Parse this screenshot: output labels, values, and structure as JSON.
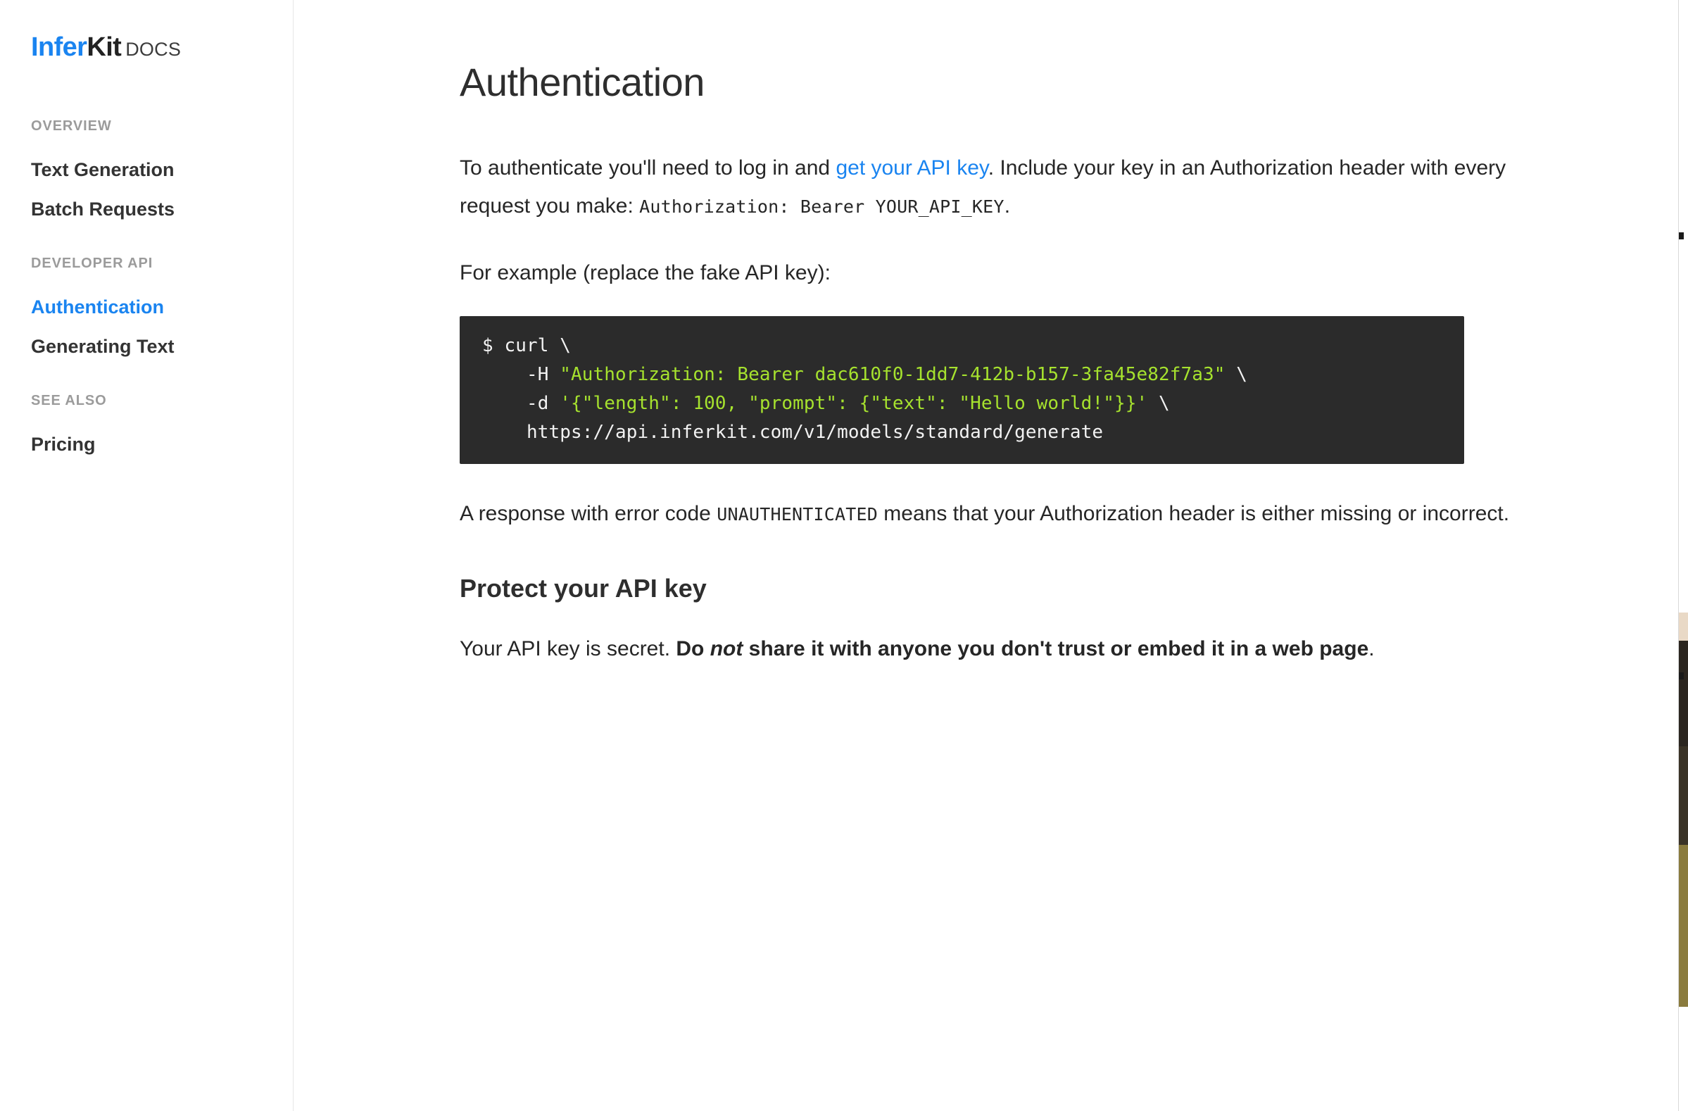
{
  "brand": {
    "infer": "Infer",
    "kit": "Kit",
    "docs": "DOCS",
    "accent_color": "#1a84f0"
  },
  "sidebar": {
    "sections": [
      {
        "header": "OVERVIEW",
        "items": [
          {
            "label": "Text Generation",
            "active": false
          },
          {
            "label": "Batch Requests",
            "active": false
          }
        ]
      },
      {
        "header": "DEVELOPER API",
        "items": [
          {
            "label": "Authentication",
            "active": true
          },
          {
            "label": "Generating Text",
            "active": false
          }
        ]
      },
      {
        "header": "SEE ALSO",
        "items": [
          {
            "label": "Pricing",
            "active": false
          }
        ]
      }
    ]
  },
  "main": {
    "title": "Authentication",
    "intro": {
      "before_link": "To authenticate you'll need to log in and ",
      "link_text": "get your API key",
      "after_link": ". Include your key in an Authorization header with every request you make: ",
      "code": "Authorization: Bearer YOUR_API_KEY",
      "end": "."
    },
    "example_label": "For example (replace the fake API key):",
    "codeblock": {
      "line1_plain": "$ curl \\",
      "line2_prefix": "    -H ",
      "line2_string": "\"Authorization: Bearer dac610f0-1dd7-412b-b157-3fa45e82f7a3\"",
      "line2_suffix": " \\",
      "line3_prefix": "    -d ",
      "line3_string": "'{\"length\": 100, \"prompt\": {\"text\": \"Hello world!\"}}'",
      "line3_suffix": " \\",
      "line4_plain": "    https://api.inferkit.com/v1/models/standard/generate",
      "api_key": "dac610f0-1dd7-412b-b157-3fa45e82f7a3",
      "endpoint_url": "https://api.inferkit.com/v1/models/standard/generate",
      "background_color": "#2b2b2b",
      "string_color": "#a6e22e"
    },
    "error_para": {
      "before_code": "A response with error code ",
      "code": "UNAUTHENTICATED",
      "after_code": " means that your Authorization header is either missing or incorrect."
    },
    "protect_heading": "Protect your API key",
    "protect_para": {
      "normal_start": "Your API key is secret. ",
      "bold_start": "Do ",
      "bold_italic": "not",
      "bold_end": " share it with anyone you don't trust or embed it in a web page",
      "period": "."
    }
  }
}
